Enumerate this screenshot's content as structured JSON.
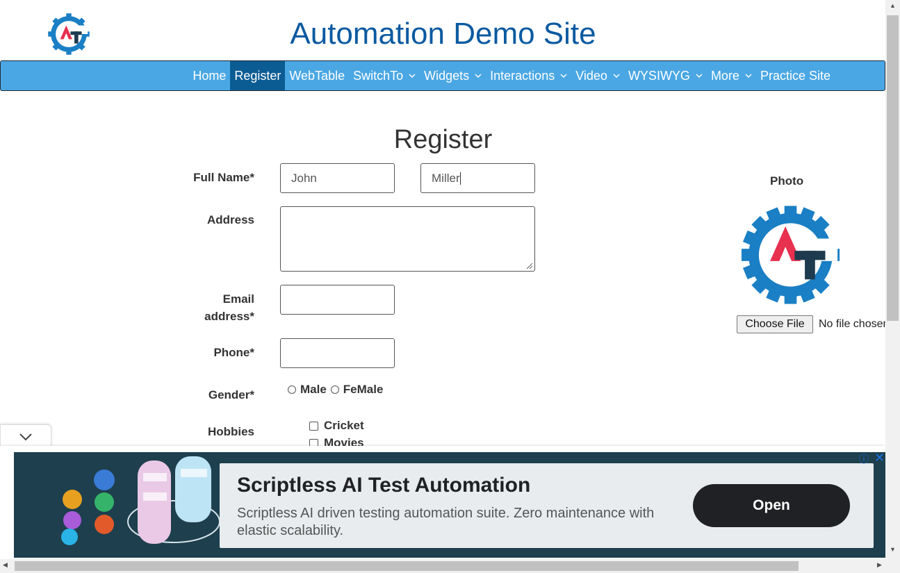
{
  "header": {
    "title": "Automation Demo Site"
  },
  "nav": {
    "items": [
      {
        "label": "Home",
        "caret": false,
        "active": false
      },
      {
        "label": "Register",
        "caret": false,
        "active": true
      },
      {
        "label": "WebTable",
        "caret": false,
        "active": false
      },
      {
        "label": "SwitchTo",
        "caret": true,
        "active": false
      },
      {
        "label": "Widgets",
        "caret": true,
        "active": false
      },
      {
        "label": "Interactions",
        "caret": true,
        "active": false
      },
      {
        "label": "Video",
        "caret": true,
        "active": false
      },
      {
        "label": "WYSIWYG",
        "caret": true,
        "active": false
      },
      {
        "label": "More",
        "caret": true,
        "active": false
      },
      {
        "label": "Practice Site",
        "caret": false,
        "active": false
      }
    ]
  },
  "form": {
    "heading": "Register",
    "full_name_label": "Full Name*",
    "first_name_value": "John",
    "last_name_value": "Miller",
    "address_label": "Address",
    "address_value": "",
    "email_label_1": "Email",
    "email_label_2": "address*",
    "email_value": "",
    "phone_label": "Phone*",
    "phone_value": "",
    "gender_label": "Gender*",
    "gender_options": [
      "Male",
      "FeMale"
    ],
    "hobbies_label": "Hobbies",
    "hobbies_options": [
      "Cricket",
      "Movies"
    ]
  },
  "photo": {
    "label": "Photo",
    "choose_file_label": "Choose File",
    "file_status": "No file chosen"
  },
  "ad": {
    "title": "Scriptless AI Test Automation",
    "description": "Scriptless AI driven testing automation suite. Zero maintenance with elastic scalability.",
    "open_label": "Open",
    "info_icon": "ⓘ",
    "close_icon": "✕"
  },
  "colors": {
    "nav_bg": "#4aa7e4",
    "nav_active": "#0c5c94",
    "title": "#0b5aa0",
    "logo_blue": "#1a7fc4",
    "logo_red": "#e8304f",
    "logo_dark": "#1d3a4f"
  }
}
